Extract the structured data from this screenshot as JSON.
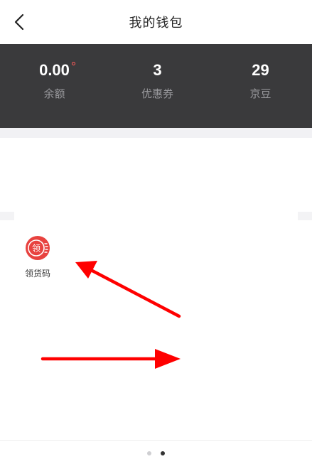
{
  "header": {
    "title": "我的钱包",
    "back_icon": "chevron-left-icon"
  },
  "stats": [
    {
      "value": "0.00",
      "label": "余额",
      "has_dot": true
    },
    {
      "value": "3",
      "label": "优惠券"
    },
    {
      "value": "29",
      "label": "京豆"
    }
  ],
  "grid": {
    "items": [
      {
        "label": "领货码",
        "icon_text": "领",
        "icon": "receive-code-icon"
      }
    ]
  },
  "pager": {
    "count": 2,
    "active_index": 1
  },
  "colors": {
    "stats_bg": "#3a3a3c",
    "accent_red": "#e8423f",
    "annotation_red": "#ff0000"
  }
}
